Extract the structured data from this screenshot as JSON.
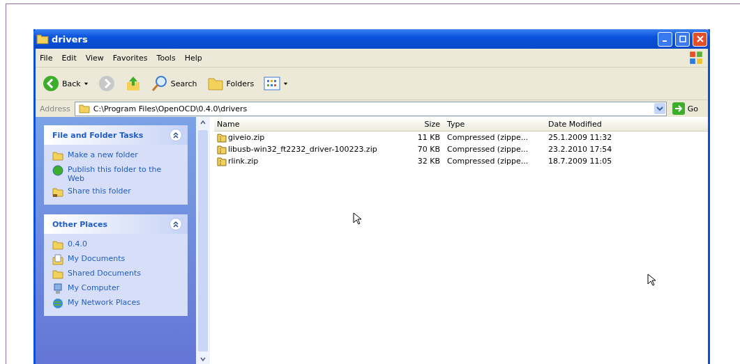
{
  "window": {
    "title": "drivers"
  },
  "menu": [
    "File",
    "Edit",
    "View",
    "Favorites",
    "Tools",
    "Help"
  ],
  "toolbar": [
    {
      "kind": "back",
      "label": "Back"
    },
    {
      "kind": "forward"
    },
    {
      "kind": "up"
    },
    {
      "kind": "search",
      "label": "Search"
    },
    {
      "kind": "folders",
      "label": "Folders"
    },
    {
      "kind": "views"
    }
  ],
  "address": {
    "label": "Address",
    "value": "C:\\Program Files\\OpenOCD\\0.4.0\\drivers",
    "go": "Go"
  },
  "panels": [
    {
      "title": "File and Folder Tasks",
      "expanded": true,
      "items": [
        {
          "kind": "newfolder",
          "label": "Make a new folder"
        },
        {
          "kind": "publish",
          "label": "Publish this folder to the Web"
        },
        {
          "kind": "share",
          "label": "Share this folder"
        }
      ]
    },
    {
      "title": "Other Places",
      "expanded": true,
      "items": [
        {
          "kind": "folder",
          "label": "0.4.0"
        },
        {
          "kind": "documents",
          "label": "My Documents"
        },
        {
          "kind": "folder",
          "label": "Shared Documents"
        },
        {
          "kind": "computer",
          "label": "My Computer"
        },
        {
          "kind": "network",
          "label": "My Network Places"
        }
      ]
    }
  ],
  "table": {
    "columns": [
      "Name",
      "Size",
      "Type",
      "Date Modified"
    ],
    "rows": [
      [
        "giveio.zip",
        "11 KB",
        "Compressed (zippe...",
        "25.1.2009 11:32"
      ],
      [
        "libusb-win32_ft2232_driver-100223.zip",
        "70 KB",
        "Compressed (zippe...",
        "23.2.2010 17:54"
      ],
      [
        "rlink.zip",
        "32 KB",
        "Compressed (zippe...",
        "18.7.2009 11:05"
      ]
    ]
  }
}
